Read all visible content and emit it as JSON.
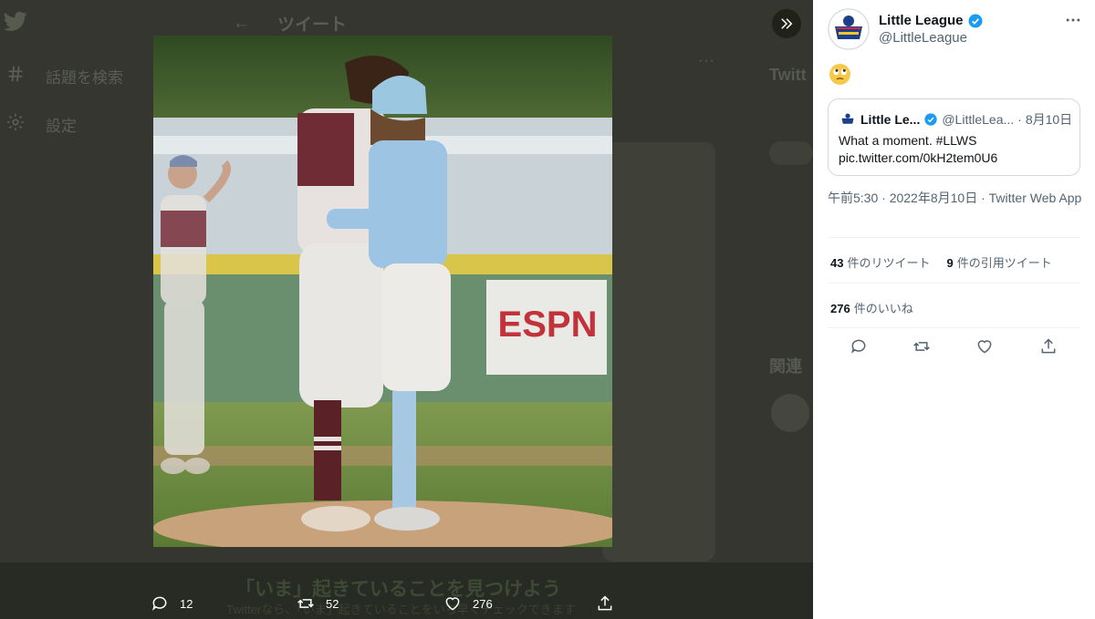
{
  "background": {
    "header_title": "ツイート",
    "nav": [
      {
        "label": "話題を検索",
        "icon": "hash-icon"
      },
      {
        "label": "設定",
        "icon": "gear-icon"
      }
    ],
    "right_title": "Twitt",
    "right_related": "関連",
    "banner_title": "「いま」起きていることを見つけよう",
    "banner_sub": "Twitterなら、「いま」起きていることをいち早くチェックできます"
  },
  "media_actions": {
    "reply_count": "12",
    "retweet_count": "52",
    "like_count": "276"
  },
  "tweet": {
    "author_name": "Little League",
    "author_handle": "@LittleLeague",
    "emoji": "🙄",
    "quote": {
      "name": "Little Le...",
      "handle": "@LittleLea...",
      "dot": "·",
      "date": "8月10日",
      "text_line1": "What a moment. #LLWS",
      "text_line2": "pic.twitter.com/0kH2tem0U6"
    },
    "timestamp": "午前5:30 · 2022年8月10日 · Twitter Web App",
    "retweets": {
      "count": "43",
      "label": "件のリツイート"
    },
    "quotes": {
      "count": "9",
      "label": "件の引用ツイート"
    },
    "likes": {
      "count": "276",
      "label": "件のいいね"
    }
  },
  "colors": {
    "accent": "#1d9bf0",
    "text_primary": "#0f1419",
    "text_secondary": "#536471",
    "overlay": "#34362f"
  }
}
